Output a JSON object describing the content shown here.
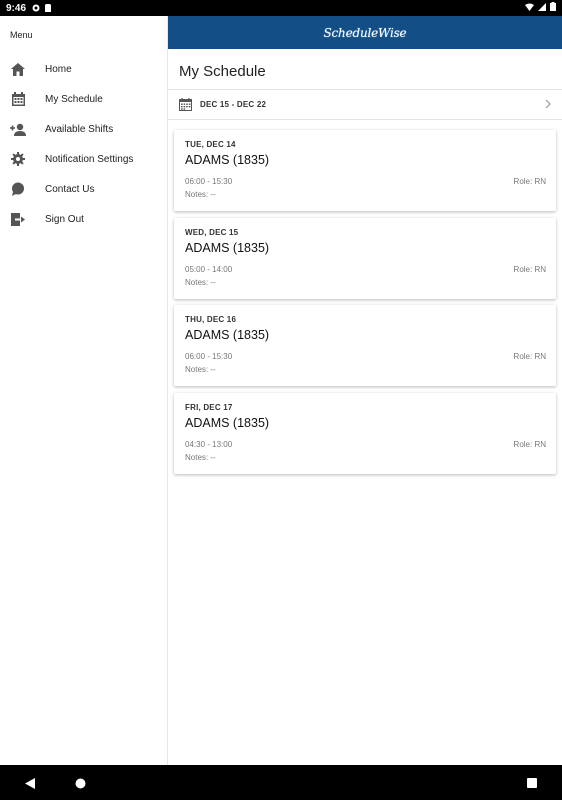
{
  "status_bar": {
    "time": "9:46"
  },
  "sidebar": {
    "title": "Menu",
    "items": [
      {
        "label": "Home",
        "icon": "home-icon"
      },
      {
        "label": "My Schedule",
        "icon": "calendar-icon"
      },
      {
        "label": "Available Shifts",
        "icon": "add-person-icon"
      },
      {
        "label": "Notification Settings",
        "icon": "gear-icon"
      },
      {
        "label": "Contact Us",
        "icon": "chat-bubble-icon"
      },
      {
        "label": "Sign Out",
        "icon": "sign-out-icon"
      }
    ]
  },
  "header": {
    "logo_text": "ScheduleWise"
  },
  "main": {
    "title": "My Schedule",
    "date_range": "DEC 15 - DEC 22",
    "shifts": [
      {
        "day": "TUE, DEC 14",
        "location": "ADAMS (1835)",
        "time": "06:00 - 15:30",
        "role": "Role: RN",
        "notes": "Notes: --"
      },
      {
        "day": "WED, DEC 15",
        "location": "ADAMS (1835)",
        "time": "05:00 - 14:00",
        "role": "Role: RN",
        "notes": "Notes: --"
      },
      {
        "day": "THU, DEC 16",
        "location": "ADAMS (1835)",
        "time": "06:00 - 15:30",
        "role": "Role: RN",
        "notes": "Notes: --"
      },
      {
        "day": "FRI, DEC 17",
        "location": "ADAMS (1835)",
        "time": "04:30 - 13:00",
        "role": "Role: RN",
        "notes": "Notes: --"
      }
    ]
  },
  "colors": {
    "header_bg": "#134e86",
    "icon": "#555555"
  }
}
